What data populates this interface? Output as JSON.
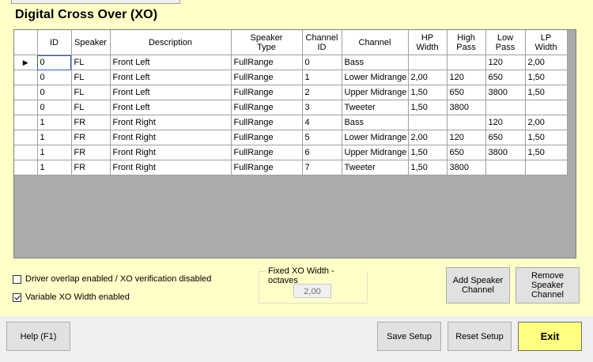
{
  "title": "Digital Cross Over (XO)",
  "grid": {
    "columns": [
      "ID",
      "Speaker",
      "Description",
      "Speaker\nType",
      "Channel\nID",
      "Channel",
      "HP\nWidth",
      "High\nPass",
      "Low\nPass",
      "LP\nWidth"
    ],
    "current_row_marker": "▶",
    "rows": [
      [
        "0",
        "FL",
        "Front Left",
        "FullRange",
        "0",
        "Bass",
        "",
        "",
        "120",
        "2,00"
      ],
      [
        "0",
        "FL",
        "Front Left",
        "FullRange",
        "1",
        "Lower Midrange",
        "2,00",
        "120",
        "650",
        "1,50"
      ],
      [
        "0",
        "FL",
        "Front Left",
        "FullRange",
        "2",
        "Upper Midrange",
        "1,50",
        "650",
        "3800",
        "1,50"
      ],
      [
        "0",
        "FL",
        "Front Left",
        "FullRange",
        "3",
        "Tweeter",
        "1,50",
        "3800",
        "",
        ""
      ],
      [
        "1",
        "FR",
        "Front Right",
        "FullRange",
        "4",
        "Bass",
        "",
        "",
        "120",
        "2,00"
      ],
      [
        "1",
        "FR",
        "Front Right",
        "FullRange",
        "5",
        "Lower Midrange",
        "2,00",
        "120",
        "650",
        "1,50"
      ],
      [
        "1",
        "FR",
        "Front Right",
        "FullRange",
        "6",
        "Upper Midrange",
        "1,50",
        "650",
        "3800",
        "1,50"
      ],
      [
        "1",
        "FR",
        "Front Right",
        "FullRange",
        "7",
        "Tweeter",
        "1,50",
        "3800",
        "",
        ""
      ]
    ]
  },
  "options": {
    "driver_overlap_label": "Driver overlap enabled / XO verification disabled",
    "driver_overlap_checked": false,
    "variable_xo_label": "Variable XO Width enabled",
    "variable_xo_checked": true
  },
  "fixed_xo": {
    "label": "Fixed XO Width - octaves",
    "value": "2,00"
  },
  "buttons": {
    "add_speaker_channel": "Add Speaker\nChannel",
    "remove_speaker_channel": "Remove\nSpeaker\nChannel",
    "help": "Help (F1)",
    "save_setup": "Save Setup",
    "reset_setup": "Reset Setup",
    "exit": "Exit"
  },
  "colors": {
    "panel_background": "#ffffc8",
    "exit_button": "#ffff80",
    "selection_outline": "#3060c0"
  }
}
